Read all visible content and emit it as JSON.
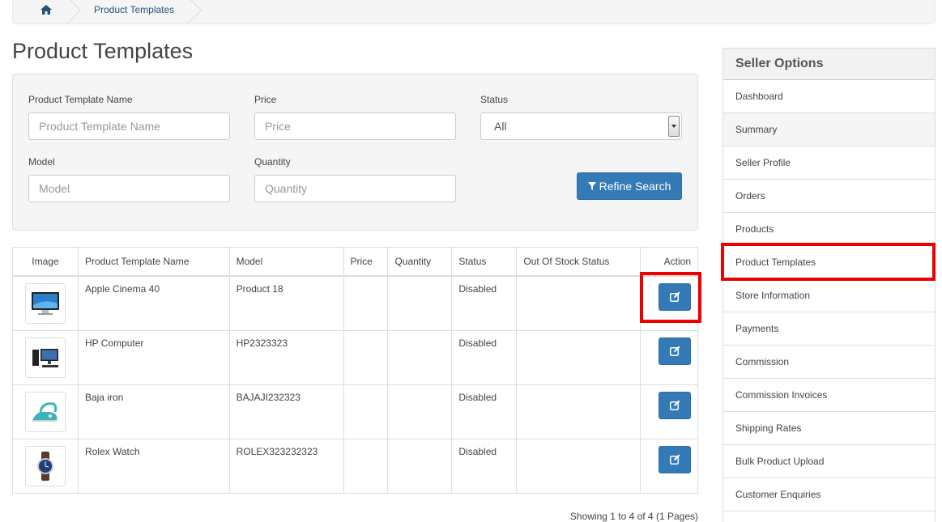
{
  "breadcrumb": {
    "home_icon": "home-icon",
    "items": [
      {
        "label": "Product Templates"
      }
    ]
  },
  "page_title": "Product Templates",
  "filters": {
    "name_label": "Product Template Name",
    "name_placeholder": "Product Template Name",
    "price_label": "Price",
    "price_placeholder": "Price",
    "status_label": "Status",
    "status_value": "All",
    "model_label": "Model",
    "model_placeholder": "Model",
    "quantity_label": "Quantity",
    "quantity_placeholder": "Quantity",
    "refine_label": "Refine Search",
    "refine_icon": "filter-icon"
  },
  "table": {
    "headers": {
      "image": "Image",
      "name": "Product Template Name",
      "model": "Model",
      "price": "Price",
      "quantity": "Quantity",
      "status": "Status",
      "stock_status": "Out Of Stock Status",
      "action": "Action"
    },
    "rows": [
      {
        "image": "monitor-image",
        "name": "Apple Cinema 40",
        "model": "Product 18",
        "price": "",
        "quantity": "",
        "status": "Disabled",
        "stock_status": ""
      },
      {
        "image": "computer-image",
        "name": "HP Computer",
        "model": "HP2323323",
        "price": "",
        "quantity": "",
        "status": "Disabled",
        "stock_status": ""
      },
      {
        "image": "iron-image",
        "name": "Baja iron",
        "model": "BAJAJI232323",
        "price": "",
        "quantity": "",
        "status": "Disabled",
        "stock_status": ""
      },
      {
        "image": "watch-image",
        "name": "Rolex Watch",
        "model": "ROLEX323232323",
        "price": "",
        "quantity": "",
        "status": "Disabled",
        "stock_status": ""
      }
    ],
    "edit_icon": "edit-icon"
  },
  "pagination": "Showing 1 to 4 of 4 (1 Pages)",
  "sidebar": {
    "heading": "Seller Options",
    "items": [
      {
        "label": "Dashboard"
      },
      {
        "label": "Summary"
      },
      {
        "label": "Seller Profile"
      },
      {
        "label": "Orders"
      },
      {
        "label": "Products"
      },
      {
        "label": "Product Templates"
      },
      {
        "label": "Store Information"
      },
      {
        "label": "Payments"
      },
      {
        "label": "Commission"
      },
      {
        "label": "Commission Invoices"
      },
      {
        "label": "Shipping Rates"
      },
      {
        "label": "Bulk Product Upload"
      },
      {
        "label": "Customer Enquiries"
      },
      {
        "label": ""
      }
    ]
  },
  "colors": {
    "primary": "#337ab7",
    "highlight": "#ee0000",
    "link": "#23527c"
  }
}
